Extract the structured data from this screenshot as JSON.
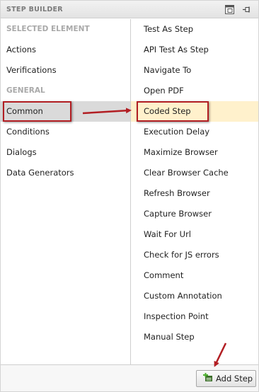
{
  "window": {
    "title": "STEP BUILDER",
    "icons": [
      "maximize-icon",
      "pin-icon"
    ]
  },
  "left_list": {
    "selected_element_header": "SELECTED ELEMENT",
    "actions": "Actions",
    "verifications": "Verifications",
    "general_header": "GENERAL",
    "common": "Common",
    "conditions": "Conditions",
    "dialogs": "Dialogs",
    "data_generators": "Data Generators",
    "selected_item": "Common"
  },
  "right_list": {
    "items": [
      "Test As Step",
      "API Test As Step",
      "Navigate To",
      "Open PDF",
      "Coded Step",
      "Execution Delay",
      "Maximize Browser",
      "Clear Browser Cache",
      "Refresh Browser",
      "Capture Browser",
      "Wait For Url",
      "Check for JS errors",
      "Comment",
      "Custom Annotation",
      "Inspection Point",
      "Manual Step"
    ],
    "highlighted_item": "Coded Step"
  },
  "footer": {
    "add_step_label": "Add Step",
    "add_step_icon": "add-step-icon"
  },
  "colors": {
    "callout": "#b21e23",
    "selected_bg": "#dadada",
    "highlight_bg": "#fff1cc",
    "header_text": "#a9a9a9"
  }
}
